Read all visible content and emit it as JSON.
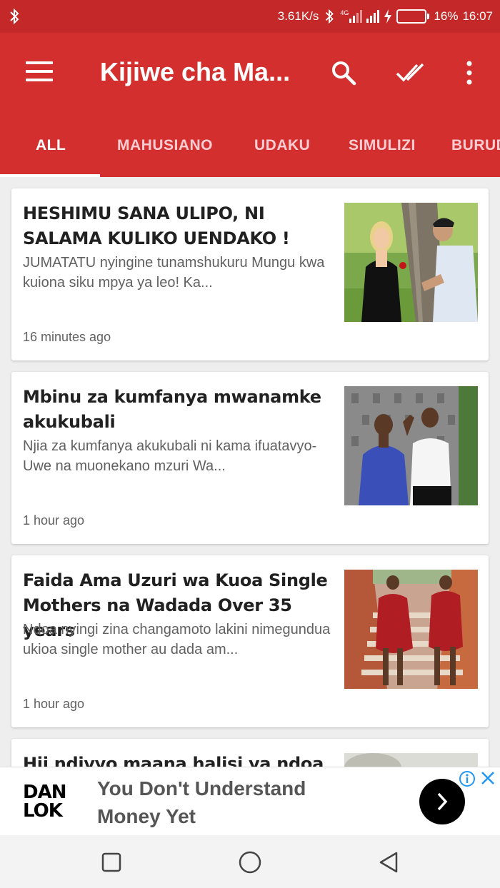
{
  "status_bar": {
    "bluetooth_icon": "bluetooth-icon",
    "net_speed": "3.61K/s",
    "network_type": "4G",
    "battery_percent": "16%",
    "battery_level": 0.16,
    "time": "16:07"
  },
  "app_bar": {
    "title": "Kijiwe cha Ma...",
    "menu_icon": "hamburger-menu-icon",
    "search_icon": "search-icon",
    "mark_read_icon": "done-all-icon",
    "overflow_icon": "more-vert-icon"
  },
  "tabs": [
    {
      "label": "ALL",
      "active": true
    },
    {
      "label": "MAHUSIANO",
      "active": false
    },
    {
      "label": "UDAKU",
      "active": false
    },
    {
      "label": "SIMULIZI",
      "active": false
    },
    {
      "label": "BURUD",
      "active": false
    }
  ],
  "articles": [
    {
      "title": "HESHIMU SANA ULIPO, NI SALAMA KULIKO UENDAKO !",
      "snippet": "JUMATATU nyingine tunamshukuru Mungu kwa kuiona siku mpya ya leo! Ka...",
      "time": "16 minutes ago"
    },
    {
      "title": "Mbinu za kumfanya mwanamke akukubali",
      "snippet": "Njia za kumfanya akukubali ni kama ifuatavyo- Uwe na muonekano mzuri Wa...",
      "time": "1 hour ago"
    },
    {
      "title": "Faida Ama Uzuri wa Kuoa Single Mothers na Wadada Over 35 years",
      "snippet": "Ndoa nyingi zina changamoto lakini nimegundua ukioa single mother au dada am...",
      "time": "1 hour ago"
    },
    {
      "title": "Hii ndivyo maana halisi ya ndoa",
      "snippet": "",
      "time": ""
    }
  ],
  "ad": {
    "logo_line1": "DAN",
    "logo_line2": "LOK",
    "line1": "You Don't Understand",
    "line2": "Money Yet"
  },
  "colors": {
    "status_bar": "#c42828",
    "app_bar": "#d32f2f",
    "background": "#eeeeee",
    "ad_info": "#2196f3"
  }
}
